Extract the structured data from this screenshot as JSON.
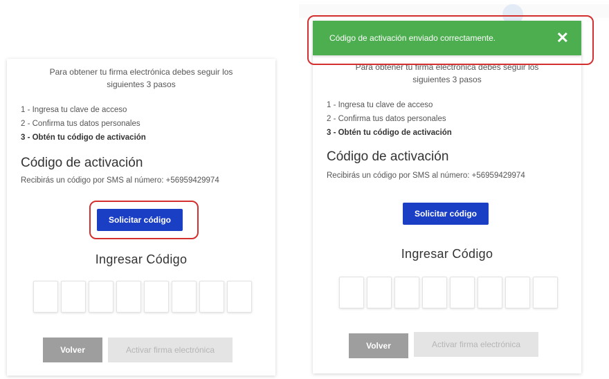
{
  "left": {
    "intro": "Para obtener tu firma electrónica debes seguir los siguientes 3 pasos",
    "steps": [
      "1 - Ingresa tu clave de acceso",
      "2 - Confirma tus datos personales",
      "3 - Obtén tu código de activación"
    ],
    "code_heading": "Código de activación",
    "sms_text": "Recibirás un código por SMS al número: +56959429974",
    "request_button": "Solicitar código",
    "enter_heading": "Ingresar Código",
    "back_button": "Volver",
    "activate_button": "Activar firma electrónica"
  },
  "right": {
    "toast_message": "Código de activación enviado correctamente.",
    "toast_close": "✕",
    "intro": "Para obtener tu firma electrónica debes seguir los siguientes 3 pasos",
    "steps": [
      "1 - Ingresa tu clave de acceso",
      "2 - Confirma tus datos personales",
      "3 - Obtén tu código de activación"
    ],
    "code_heading": "Código de activación",
    "sms_text": "Recibirás un código por SMS al número: +56959429974",
    "request_button": "Solicitar código",
    "enter_heading": "Ingresar Código",
    "back_button": "Volver",
    "activate_button": "Activar firma electrónica"
  },
  "colors": {
    "primary": "#1a3fc4",
    "success": "#4cae4f",
    "highlight": "#d32f2f",
    "disabled": "#9e9e9e"
  }
}
